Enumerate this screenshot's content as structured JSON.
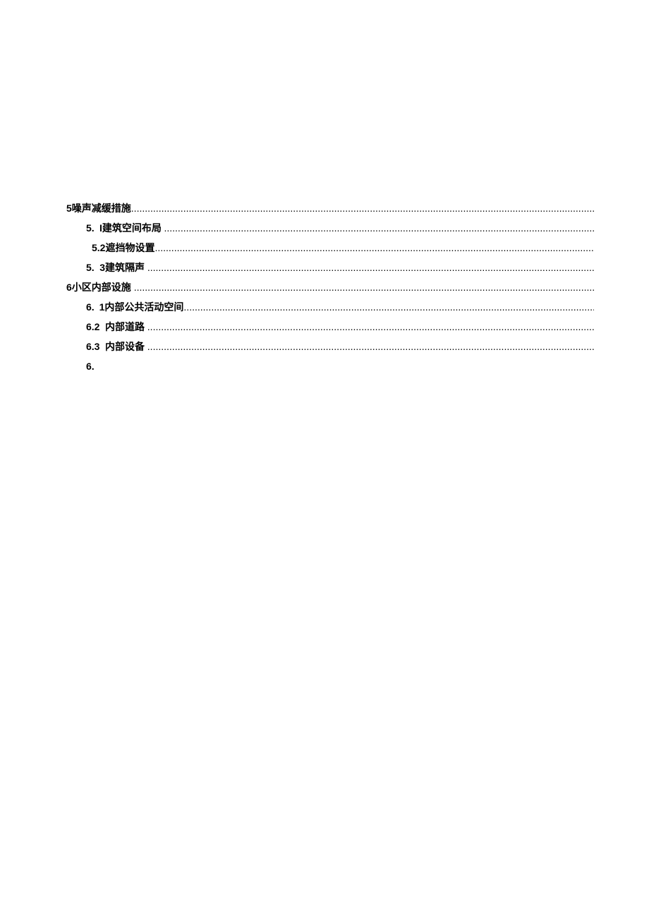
{
  "toc": {
    "line1_pre": "5噪声减缓措施",
    "line2_num": "5.",
    "line2_txt": "I建筑空间布局",
    "line3_pre": "5.2遮挡物设置",
    "line4_num": "5.",
    "line4_txt": "3建筑隔声",
    "line5_pre": "6小区内部设施",
    "line6_num": "6.",
    "line6_txt": "1内部公共活动空间",
    "line7_num": "6.2",
    "line7_txt": "内部道路",
    "line8_num": "6.3",
    "line8_txt": "内部设备",
    "line9_num": "6."
  }
}
